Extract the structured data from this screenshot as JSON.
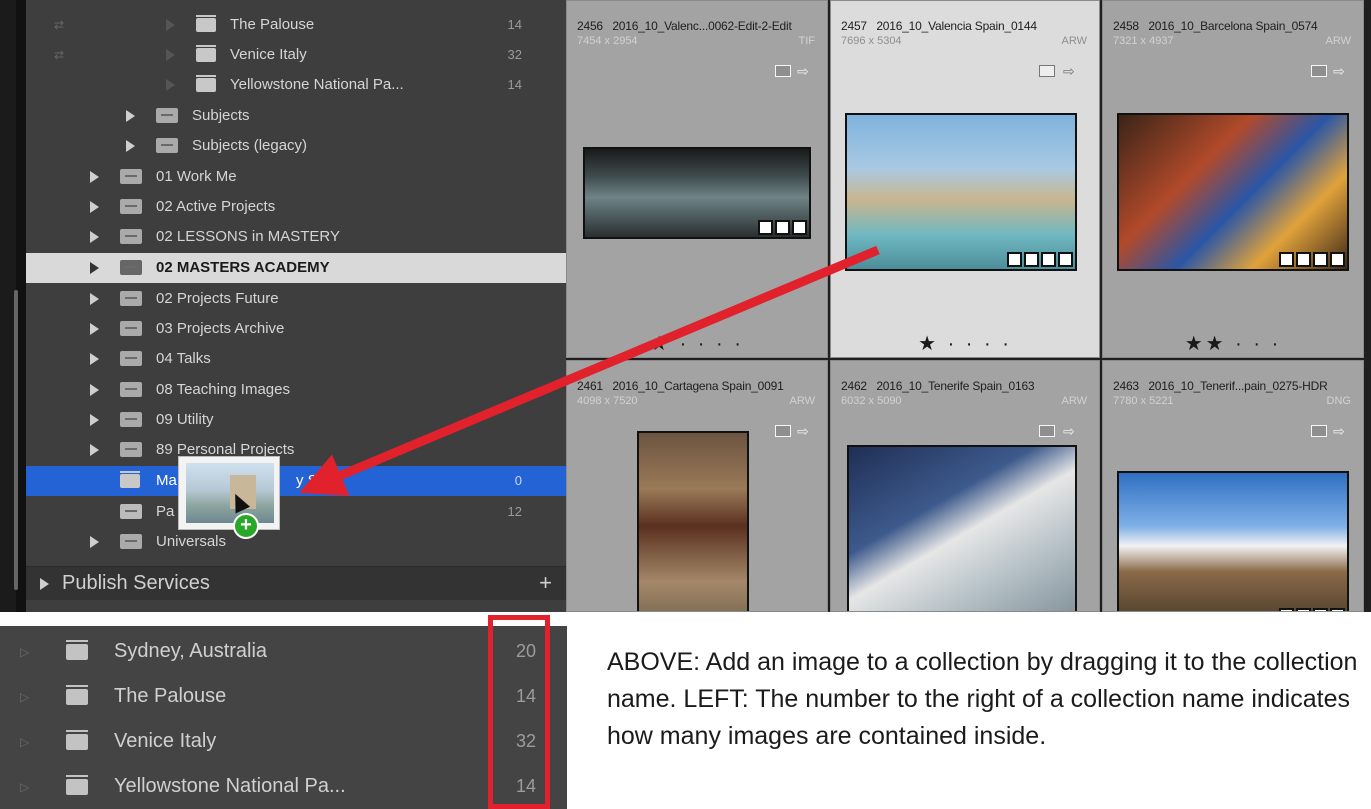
{
  "collections_panel": {
    "rows": [
      {
        "label": "The Palouse",
        "count": "14"
      },
      {
        "label": "Venice Italy",
        "count": "32"
      },
      {
        "label": "Yellowstone National Pa...",
        "count": "14"
      },
      {
        "label": "Subjects",
        "count": ""
      },
      {
        "label": "Subjects (legacy)",
        "count": ""
      },
      {
        "label": "01 Work Me",
        "count": ""
      },
      {
        "label": "02 Active Projects",
        "count": ""
      },
      {
        "label": "02 LESSONS in MASTERY",
        "count": ""
      },
      {
        "label": "02 MASTERS ACADEMY",
        "count": ""
      },
      {
        "label": "02 Projects Future",
        "count": ""
      },
      {
        "label": "03 Projects Archive",
        "count": ""
      },
      {
        "label": "04 Talks",
        "count": ""
      },
      {
        "label": "08 Teaching Images",
        "count": ""
      },
      {
        "label": "09 Utility",
        "count": ""
      },
      {
        "label": "89 Personal Projects",
        "count": ""
      },
      {
        "label": "Ma",
        "count": "0"
      },
      {
        "label": "Pa",
        "count": "12"
      },
      {
        "label": "Universals",
        "count": ""
      }
    ],
    "drag_target_label_tail": "y Stuff",
    "publish_services": {
      "label": "Publish Services",
      "add": "+"
    }
  },
  "grid": {
    "cells": [
      {
        "index": "2456",
        "name": "2016_10_Valenc...0062-Edit-2-Edit",
        "size": "7454 x 2954",
        "ext": "TIF",
        "stars": "★ · · · ·"
      },
      {
        "index": "2457",
        "name": "2016_10_Valencia Spain_0144",
        "size": "7696 x 5304",
        "ext": "ARW",
        "stars": "★ · · · ·"
      },
      {
        "index": "2458",
        "name": "2016_10_Barcelona Spain_0574",
        "size": "7321 x 4937",
        "ext": "ARW",
        "stars": "★★ · · ·"
      },
      {
        "index": "2461",
        "name": "2016_10_Cartagena Spain_0091",
        "size": "4098 x 7520",
        "ext": "ARW",
        "stars": ""
      },
      {
        "index": "2462",
        "name": "2016_10_Tenerife Spain_0163",
        "size": "6032 x 5090",
        "ext": "ARW",
        "stars": ""
      },
      {
        "index": "2463",
        "name": "2016_10_Tenerif...pain_0275-HDR",
        "size": "7780 x 5221",
        "ext": "DNG",
        "stars": ""
      }
    ]
  },
  "inset": {
    "rows": [
      {
        "label": "Sydney, Australia",
        "count": "20"
      },
      {
        "label": "The Palouse",
        "count": "14"
      },
      {
        "label": "Venice Italy",
        "count": "32"
      },
      {
        "label": "Yellowstone National Pa...",
        "count": "14"
      }
    ]
  },
  "caption": "ABOVE: Add an image to a collection by dragging it to the collection name. LEFT: The number to the right of a collection name indicates how many images are contained inside.",
  "colors": {
    "selection_blue": "#2463d6",
    "annotation_red": "#e1212c",
    "add_green": "#29a729"
  }
}
